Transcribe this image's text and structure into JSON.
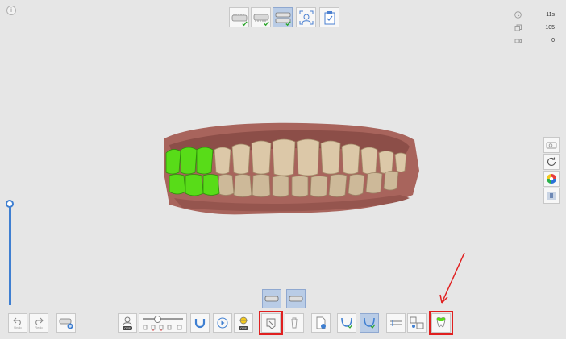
{
  "info": {
    "glyph": "i"
  },
  "top_steps": [
    {
      "name": "step-upper-jaw",
      "icon": "upper-jaw-icon",
      "done": true,
      "active": false
    },
    {
      "name": "step-lower-jaw",
      "icon": "lower-jaw-icon",
      "done": true,
      "active": false
    },
    {
      "name": "step-occlusion",
      "icon": "occlusion-icon",
      "done": true,
      "active": true
    },
    {
      "name": "step-face-scan",
      "icon": "face-scan-icon",
      "done": false,
      "active": false
    },
    {
      "name": "step-review",
      "icon": "clipboard-check-icon",
      "done": false,
      "active": false
    }
  ],
  "stats": {
    "time": "11s",
    "images": "105",
    "frames": "0"
  },
  "right_toolbar": [
    {
      "name": "video-icon"
    },
    {
      "name": "reset-view-icon"
    },
    {
      "name": "color-palette-icon"
    },
    {
      "name": "shade-icon"
    }
  ],
  "bottom_left": {
    "undo_label": "Undo",
    "redo_label": "Redo"
  },
  "mini_views": [
    {
      "name": "occlusion-view-upper",
      "active": true
    },
    {
      "name": "occlusion-view-lower",
      "active": true
    }
  ],
  "toolbar_toggle_labels": {
    "face_toggle": "OFF",
    "ai_toggle": "OFF"
  },
  "colors": {
    "accent": "#3f7fd1",
    "highlight": "#e02020",
    "active_bg": "#b9cce6",
    "green_area": "#58dc18"
  }
}
